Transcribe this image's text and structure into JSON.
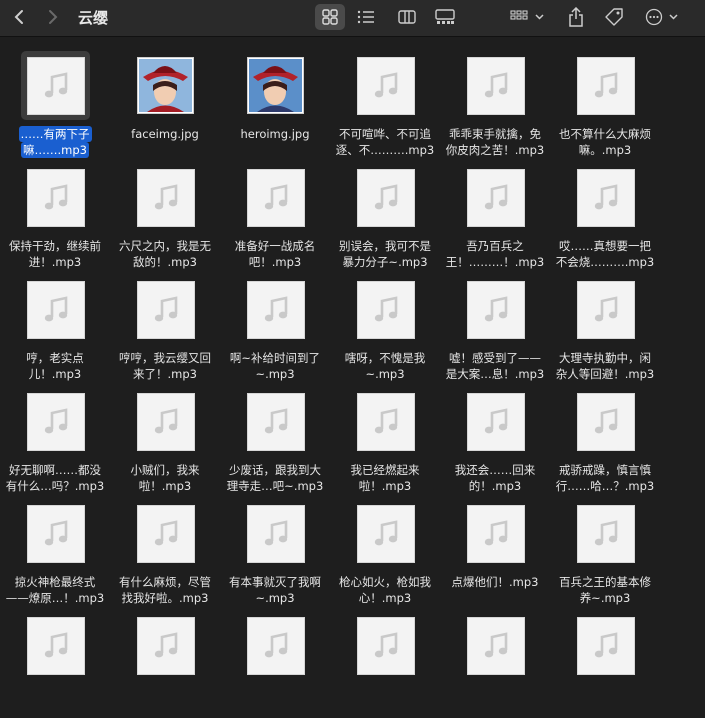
{
  "window": {
    "title": "云缨"
  },
  "toolbar": {
    "icons": [
      "chevron-left-icon",
      "chevron-right-icon",
      "grid-view-icon",
      "list-view-icon",
      "column-view-icon",
      "gallery-view-icon",
      "group-icon",
      "share-icon",
      "tag-icon",
      "more-icon"
    ]
  },
  "files": [
    {
      "line1": "……有两下子",
      "line2": "嘛…….mp3",
      "type": "audio",
      "selected": true
    },
    {
      "line1": "faceimg.jpg",
      "line2": "",
      "type": "image"
    },
    {
      "line1": "heroimg.jpg",
      "line2": "",
      "type": "image"
    },
    {
      "line1": "不可喧哗、不可追",
      "line2": "逐、不……….mp3",
      "type": "audio"
    },
    {
      "line1": "乖乖束手就擒，免",
      "line2": "你皮肉之苦！.mp3",
      "type": "audio"
    },
    {
      "line1": "也不算什么大麻烦",
      "line2": "嘛。.mp3",
      "type": "audio"
    },
    {
      "line1": "保持干劲，继续前",
      "line2": "进！.mp3",
      "type": "audio"
    },
    {
      "line1": "六尺之内，我是无",
      "line2": "敌的！.mp3",
      "type": "audio"
    },
    {
      "line1": "准备好一战成名",
      "line2": "吧！.mp3",
      "type": "audio"
    },
    {
      "line1": "别误会，我可不是",
      "line2": "暴力分子~.mp3",
      "type": "audio"
    },
    {
      "line1": "吾乃百兵之",
      "line2": "王！………！.mp3",
      "type": "audio"
    },
    {
      "line1": "哎……真想要一把",
      "line2": "不会烧……….mp3",
      "type": "audio"
    },
    {
      "line1": "哼，老实点",
      "line2": "儿！.mp3",
      "type": "audio"
    },
    {
      "line1": "哼哼，我云缨又回",
      "line2": "来了！.mp3",
      "type": "audio"
    },
    {
      "line1": "啊~补给时间到了",
      "line2": "~.mp3",
      "type": "audio"
    },
    {
      "line1": "嗐呀，不愧是我",
      "line2": "~.mp3",
      "type": "audio"
    },
    {
      "line1": "嘘！感受到了——",
      "line2": "是大案…息！.mp3",
      "type": "audio"
    },
    {
      "line1": "大理寺执勤中，闲",
      "line2": "杂人等回避！.mp3",
      "type": "audio"
    },
    {
      "line1": "好无聊啊……都没",
      "line2": "有什么…吗？.mp3",
      "type": "audio"
    },
    {
      "line1": "小贼们，我来",
      "line2": "啦！.mp3",
      "type": "audio"
    },
    {
      "line1": "少废话，跟我到大",
      "line2": "理寺走…吧~.mp3",
      "type": "audio"
    },
    {
      "line1": "我已经燃起来",
      "line2": "啦！.mp3",
      "type": "audio"
    },
    {
      "line1": "我还会……回来",
      "line2": "的！.mp3",
      "type": "audio"
    },
    {
      "line1": "戒骄戒躁，慎言慎",
      "line2": "行……哈…？.mp3",
      "type": "audio"
    },
    {
      "line1": "掠火神枪最终式",
      "line2": "——燎原…！.mp3",
      "type": "audio"
    },
    {
      "line1": "有什么麻烦，尽管",
      "line2": "找我好啦。.mp3",
      "type": "audio"
    },
    {
      "line1": "有本事就灭了我啊",
      "line2": "~.mp3",
      "type": "audio"
    },
    {
      "line1": "枪心如火，枪如我",
      "line2": "心！.mp3",
      "type": "audio"
    },
    {
      "line1": "点爆他们！.mp3",
      "line2": "",
      "type": "audio"
    },
    {
      "line1": "百兵之王的基本修",
      "line2": "养~.mp3",
      "type": "audio"
    },
    {
      "line1": "",
      "line2": "",
      "type": "audio"
    },
    {
      "line1": "",
      "line2": "",
      "type": "audio"
    },
    {
      "line1": "",
      "line2": "",
      "type": "audio"
    },
    {
      "line1": "",
      "line2": "",
      "type": "audio"
    },
    {
      "line1": "",
      "line2": "",
      "type": "audio"
    },
    {
      "line1": "",
      "line2": "",
      "type": "audio"
    }
  ]
}
